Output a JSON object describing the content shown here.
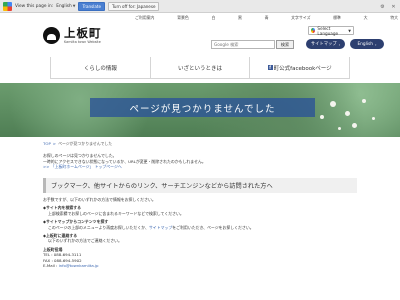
{
  "translate_bar": {
    "view_label": "View this page in:",
    "language": "English",
    "translate_button": "Translate",
    "off_button": "Turn off for: Japanese"
  },
  "utility_links": [
    "ご利用案内",
    "背景色",
    "白",
    "黒",
    "青",
    "文字サイズ",
    "標準",
    "大",
    "特大"
  ],
  "logo": {
    "title": "上板町",
    "subtitle": "Kamiita town Website"
  },
  "select_language": "Select Language",
  "search": {
    "placeholder": "Google 検索",
    "button": "検索"
  },
  "buttons": {
    "sitemap": "サイトマップ",
    "english": "English"
  },
  "nav": {
    "items": [
      "くらしの情報",
      "いざというときは",
      "町公式facebookページ"
    ]
  },
  "hero": {
    "title": "ページが見つかりませんでした"
  },
  "breadcrumb": {
    "home": "TOP",
    "sep": ">",
    "current": "ページが見つかりませんでした"
  },
  "intro": {
    "line1": "お探しのページは見つかりませんでした。",
    "line2": "一時的にアクセスできない状態になっているか、URLが変更・削除されたのかもしれません。",
    "link_home": "上板町ホームページ",
    "link_sitemap": "トップページへ"
  },
  "notice": "ブックマーク、他サイトからのリンク、サーチエンジンなどから訪問された方へ",
  "guidance": {
    "lead": "お手数ですが、以下のいずれかの方法で情報をお探しください。",
    "search_heading": "◆サイト内を検索する",
    "search_text": "上部検索欄でお探しのページに含まれるキーワードなどで検索してください。",
    "sitemap_heading": "◆サイトマップからコンテンツを探す",
    "sitemap_text_before": "このページの上部のメニューより再度お探しいただくか、",
    "sitemap_link": "サイトマップ",
    "sitemap_text_after": "をご利用いただき、ページをお探しください。",
    "contact_heading": "◆上板町に連絡する",
    "contact_text": "以下のいずれかの方法でご連絡ください。"
  },
  "contact": {
    "org": "上板町役場",
    "tel": "TEL : 088-694-3111",
    "fax": "FAX : 088-694-5902",
    "email_label": "E-Mail : ",
    "email": "info@townkamiita.jp"
  }
}
